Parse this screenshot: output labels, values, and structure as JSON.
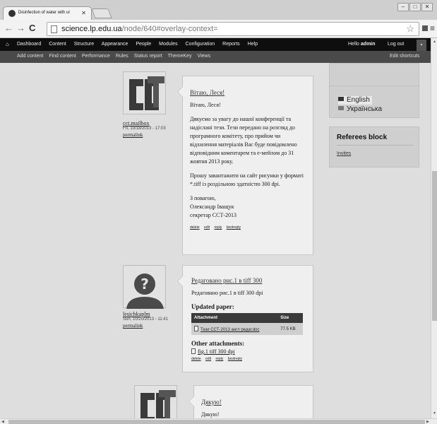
{
  "browser": {
    "tab_title": "Disinfection of water with ul",
    "url_host": "science.lp.edu.ua",
    "url_path": "/node/640#overlay-context="
  },
  "admin_toolbar": {
    "items": [
      "Dashboard",
      "Content",
      "Structure",
      "Appearance",
      "People",
      "Modules",
      "Configuration",
      "Reports",
      "Help"
    ],
    "hello_prefix": "Hello ",
    "username": "admin",
    "logout": "Log out"
  },
  "shortcuts": {
    "items": [
      "Add content",
      "Find content",
      "Performance",
      "Rules",
      "Status report",
      "ThemeKey",
      "Views"
    ],
    "edit": "Edit shortcuts"
  },
  "comments": [
    {
      "author": "cct.mailbox",
      "date": "Fri, 10/18/2013 - 17:03",
      "permalink": "permalink",
      "title": "Вітаю, Леся!",
      "paragraphs": [
        "Вітаю, Леся!",
        "Дякуємо за увагу до нашої конференції та надіслані тези. Тези передано на розгляд до програмного комітету, про прийом чи відхилення матеріалів Вас буде повідомлено відповідним коментарем та е-мейлом до 31 жовтня 2013 року.",
        "Прошу завантажити на сайт рисунки у форматі *.tiff із роздільною здатністю 300 dpi.",
        "З повагою,\nОлександр Іващук\nсекретар ССТ-2013"
      ],
      "links": [
        "delete",
        "edit",
        "reply",
        "bestreply"
      ]
    },
    {
      "author": "lesichkaplm",
      "date": "Sun, 10/20/2013 - 11:41",
      "permalink": "permalink",
      "title": "Редаговано рис.1 в tiff 300",
      "body": "Редаговано рис.1 в tiff 300 dpi",
      "updated_heading": "Updated paper:",
      "table": {
        "headers": [
          "Attachment",
          "Size"
        ],
        "rows": [
          [
            "Тези ССТ-2013 англ редаг.doc",
            "77.5 KB"
          ]
        ]
      },
      "other_heading": "Other attachments:",
      "other_file": "fig.1 tiff 300 dpi",
      "links": [
        "delete",
        "edit",
        "reply",
        "bestreply"
      ]
    },
    {
      "title": "Дякую!",
      "body": "Дякую!"
    }
  ],
  "sidebar": {
    "languages": [
      "English",
      "Українська"
    ],
    "referees_title": "Referees block",
    "invites": "Invites"
  },
  "colors": {
    "admin_bar": "#0e0e0e",
    "shortcut_bar": "#4a4a4a",
    "table_header": "#3a3a3a"
  }
}
